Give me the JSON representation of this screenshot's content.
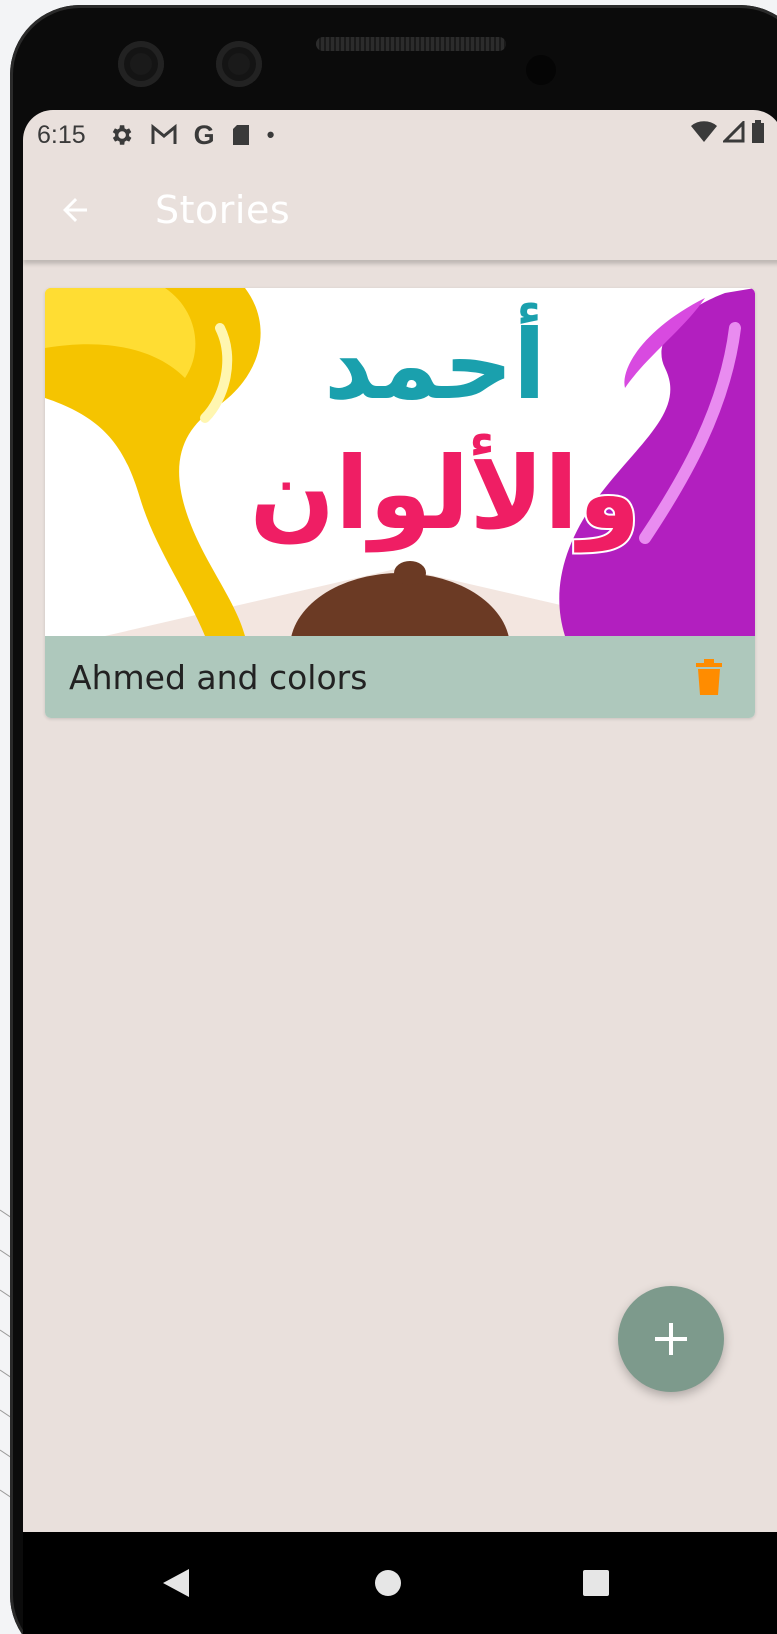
{
  "status_bar": {
    "time": "6:15",
    "icons": [
      "gear-icon",
      "gmail-icon",
      "google-icon",
      "sd-card-icon",
      "dot-icon"
    ],
    "right_icons": [
      "wifi-icon",
      "signal-icon",
      "battery-icon"
    ],
    "google_glyph": "G",
    "dot_glyph": "•"
  },
  "app_bar": {
    "title": "Stories",
    "back_icon": "arrow-back-icon"
  },
  "stories": [
    {
      "title": "Ahmed and colors",
      "cover_title_line1": "أحمد",
      "cover_title_line2": "والألوان",
      "delete_icon": "trash-icon"
    }
  ],
  "fab": {
    "icon": "plus-icon"
  },
  "nav_bar": {
    "icons": [
      "back-triangle-icon",
      "home-circle-icon",
      "recents-square-icon"
    ]
  },
  "colors": {
    "screen_bg": "#e9e0dc",
    "card_footer": "#aec8bc",
    "fab": "#7d9a8c",
    "delete_icon": "#ff8c00",
    "title_teal": "#1aa0ad",
    "title_pink": "#ef1e64",
    "title_orange": "#f7a21b"
  }
}
